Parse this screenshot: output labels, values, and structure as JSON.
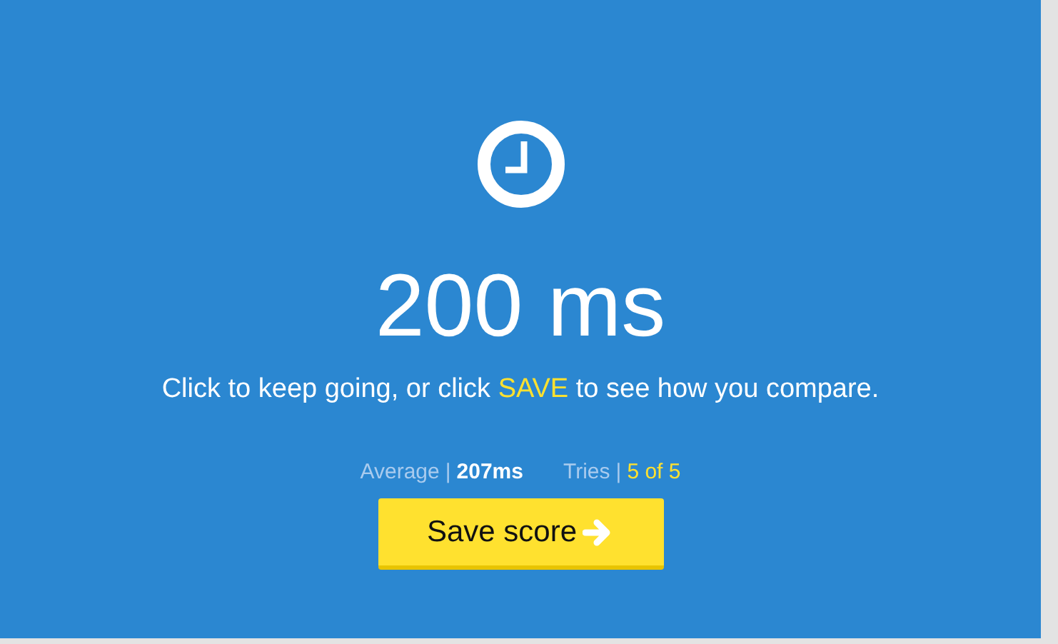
{
  "result": "200 ms",
  "instruction": {
    "before": "Click to keep going, or click ",
    "highlight": "SAVE",
    "after": " to see how you compare."
  },
  "stats": [
    {
      "label": "Average",
      "separator": "|",
      "value": "207ms",
      "kind": "plain"
    },
    {
      "label": "Tries",
      "separator": "|",
      "value": "5 of 5",
      "kind": "highlight"
    }
  ],
  "button": {
    "label": "Save score"
  }
}
